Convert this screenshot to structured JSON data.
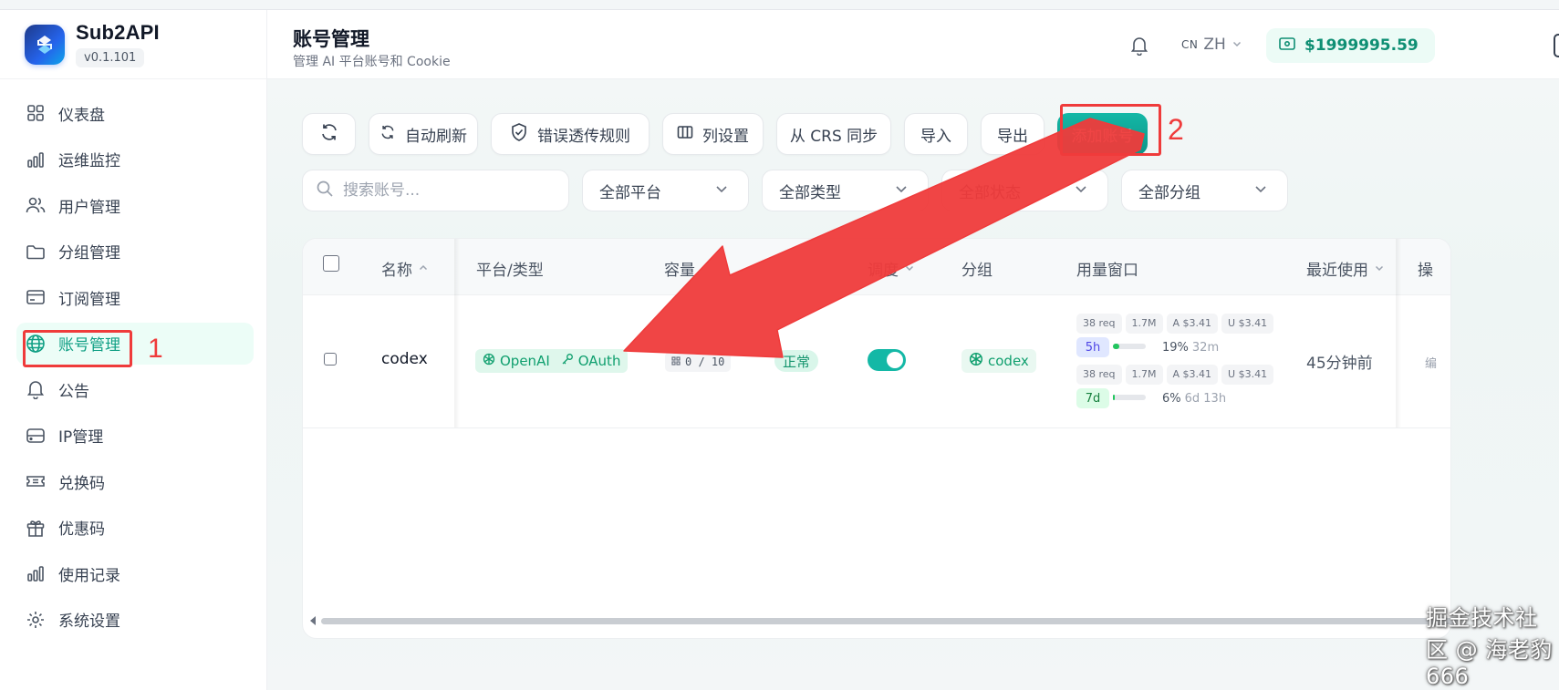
{
  "brand": {
    "name": "Sub2API",
    "version": "v0.1.101"
  },
  "sidebar": {
    "items": [
      {
        "label": "仪表盘",
        "icon": "grid-icon"
      },
      {
        "label": "运维监控",
        "icon": "bar-chart-icon"
      },
      {
        "label": "用户管理",
        "icon": "users-icon"
      },
      {
        "label": "分组管理",
        "icon": "folder-icon"
      },
      {
        "label": "订阅管理",
        "icon": "card-icon"
      },
      {
        "label": "账号管理",
        "icon": "globe-icon",
        "active": true
      },
      {
        "label": "公告",
        "icon": "bell-icon"
      },
      {
        "label": "IP管理",
        "icon": "server-icon"
      },
      {
        "label": "兑换码",
        "icon": "ticket-icon"
      },
      {
        "label": "优惠码",
        "icon": "gift-icon"
      },
      {
        "label": "使用记录",
        "icon": "bar-chart-icon"
      },
      {
        "label": "系统设置",
        "icon": "gear-icon"
      }
    ]
  },
  "annotations": {
    "step1": "1",
    "step2": "2",
    "highlight_color": "#ef3b3b"
  },
  "header": {
    "title": "账号管理",
    "subtitle": "管理 AI 平台账号和 Cookie",
    "lang_code": "CN",
    "lang": "ZH",
    "balance": "$1999995.59"
  },
  "toolbar": {
    "refresh_icon": "refresh-icon",
    "auto_refresh": "自动刷新",
    "error_rules": "错误透传规则",
    "column_settings": "列设置",
    "crs_sync": "从 CRS 同步",
    "import": "导入",
    "export": "导出",
    "add_account": "添加账号"
  },
  "filters": {
    "search_placeholder": "搜索账号...",
    "platform": "全部平台",
    "type": "全部类型",
    "status": "全部状态",
    "group": "全部分组"
  },
  "table": {
    "columns": {
      "name": "名称",
      "platform_type": "平台/类型",
      "capacity": "容量",
      "schedule": "调度",
      "group": "分组",
      "usage_window": "用量窗口",
      "last_used": "最近使用",
      "actions": "操"
    },
    "rows": [
      {
        "name": "codex",
        "platform": "OpenAI",
        "auth": "OAuth",
        "capacity": "0 / 10",
        "status": "正常",
        "schedule_enabled": true,
        "group": "codex",
        "windows": [
          {
            "req": "38 req",
            "tokens": "1.7M",
            "a_cost": "A $3.41",
            "u_cost": "U $3.41",
            "label": "5h",
            "percent": "19%",
            "percent_value": 0.19,
            "reset": "32m",
            "label_bg": "#e0e7ff",
            "label_color": "#4f46e5"
          },
          {
            "req": "38 req",
            "tokens": "1.7M",
            "a_cost": "A $3.41",
            "u_cost": "U $3.41",
            "label": "7d",
            "percent": "6%",
            "percent_value": 0.06,
            "reset": "6d 13h",
            "label_bg": "#dcfce7",
            "label_color": "#15803d"
          }
        ],
        "last_used": "45分钟前",
        "actions_partial": "编"
      }
    ]
  },
  "watermark": "掘金技术社区 @ 海老豹666",
  "colors": {
    "accent": "#14b8a6",
    "active_bg": "#ecfdf7",
    "active_text": "#0f9f84",
    "tag_bg": "#dff7ec"
  }
}
